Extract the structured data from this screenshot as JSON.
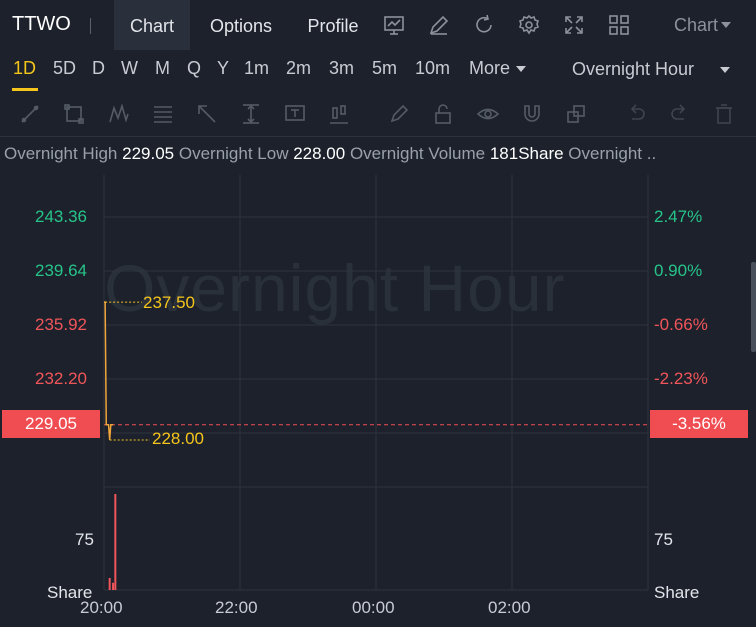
{
  "header": {
    "symbol": "TTWO",
    "tabs": [
      "Chart",
      "Options",
      "Profile"
    ],
    "active_tab": "Chart",
    "chart_select": "Chart",
    "icons": [
      "indicator-chart-icon",
      "draw-pen-icon",
      "refresh-icon",
      "settings-gear-icon",
      "fullscreen-icon",
      "layout-grid-icon"
    ]
  },
  "timeframes": {
    "items": [
      "1D",
      "5D",
      "D",
      "W",
      "M",
      "Q",
      "Y",
      "1m",
      "2m",
      "3m",
      "5m",
      "10m",
      "More"
    ],
    "active": "1D",
    "session": "Overnight Hour"
  },
  "drawing_tools": [
    "trend-line-icon",
    "rectangle-icon",
    "pattern-icon",
    "fib-icon",
    "arrow-icon",
    "measure-icon",
    "text-icon",
    "position-icon",
    "brush-icon",
    "lock-icon",
    "eye-icon",
    "magnet-icon",
    "group-icon",
    "undo-icon",
    "redo-icon",
    "trash-icon"
  ],
  "info": {
    "items": [
      {
        "label": "Overnight High",
        "value": "229.05"
      },
      {
        "label": "Overnight Low",
        "value": "228.00"
      },
      {
        "label": "Overnight Volume",
        "value": "181Share"
      },
      {
        "label": "Overnight ..",
        "value": ""
      }
    ]
  },
  "chart_data": {
    "type": "line",
    "watermark": "Overnight Hour",
    "price_axis_left": [
      "243.36",
      "239.64",
      "235.92",
      "232.20"
    ],
    "price_axis_right": [
      "2.47%",
      "0.90%",
      "-0.66%",
      "-2.23%"
    ],
    "current_price": "229.05",
    "current_pct": "-3.56%",
    "annotations": [
      {
        "label": "237.50",
        "value": 237.5
      },
      {
        "label": "228.00",
        "value": 228.0
      }
    ],
    "x_ticks": [
      "20:00",
      "22:00",
      "00:00",
      "02:00"
    ],
    "volume_axis_left": [
      "75",
      "Share"
    ],
    "volume_axis_right": [
      "75",
      "Share"
    ],
    "ylim": [
      226.5,
      245.2
    ],
    "series": [
      {
        "x": [
          "20:00",
          "20:01",
          "20:02",
          "20:04",
          "20:05",
          "20:06",
          "20:08"
        ],
        "values": [
          237.5,
          237.5,
          229.05,
          229.05,
          228.0,
          229.05,
          229.05
        ]
      }
    ],
    "volume": [
      {
        "x": "20:05",
        "value": 20
      },
      {
        "x": "20:08",
        "value": 12
      },
      {
        "x": "20:10",
        "value": 160
      }
    ],
    "colors": {
      "line": "#f0a53a",
      "up": "#27c48a",
      "down": "#f0555a",
      "accent": "#f5c51c"
    }
  }
}
